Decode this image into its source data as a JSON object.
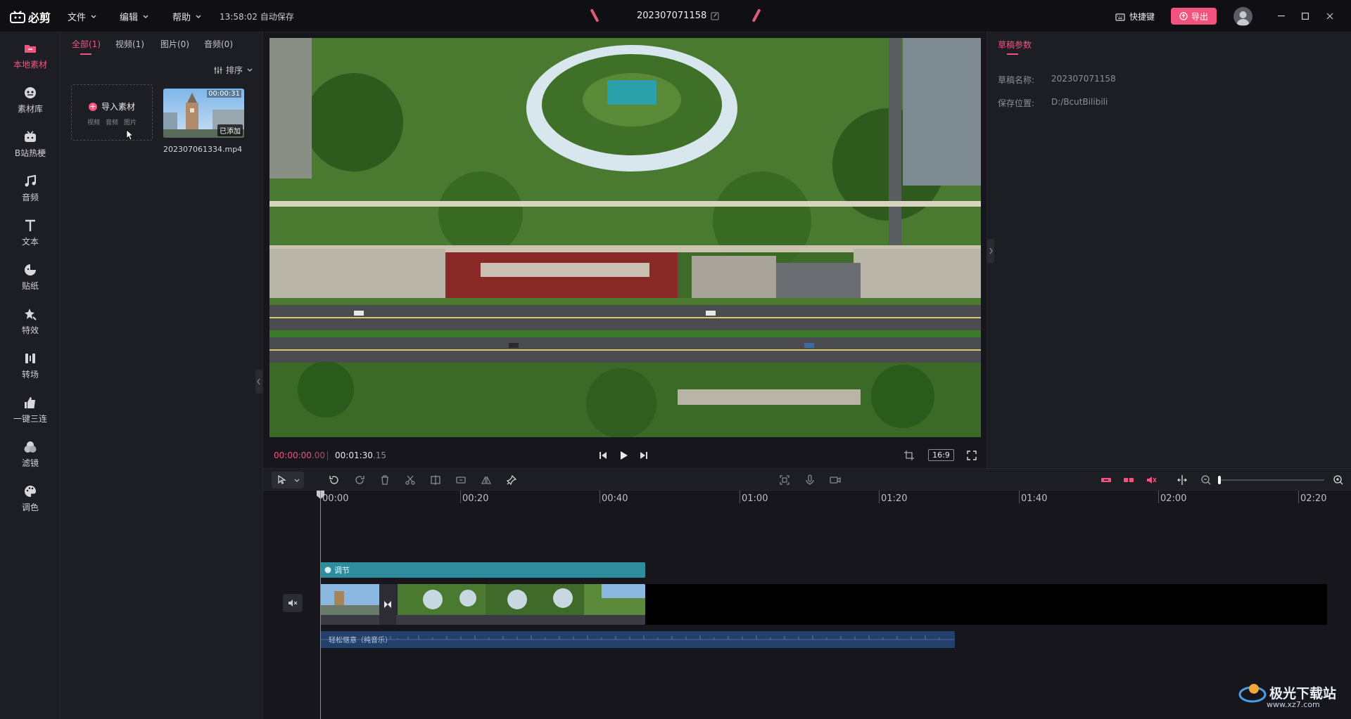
{
  "app": {
    "logo": "必剪",
    "autosave": "13:58:02 自动保存",
    "project_title": "202307071158"
  },
  "menus": [
    {
      "label": "文件"
    },
    {
      "label": "编辑"
    },
    {
      "label": "帮助"
    }
  ],
  "topbar": {
    "shortcut_label": "快捷键",
    "export_label": "导出"
  },
  "sidebar": {
    "items": [
      {
        "label": "本地素材",
        "icon": "folder-icon",
        "active": true
      },
      {
        "label": "素材库",
        "icon": "material-library-icon"
      },
      {
        "label": "B站热梗",
        "icon": "bilibili-tv-icon"
      },
      {
        "label": "音频",
        "icon": "music-note-icon"
      },
      {
        "label": "文本",
        "icon": "text-icon"
      },
      {
        "label": "贴纸",
        "icon": "sticker-icon"
      },
      {
        "label": "特效",
        "icon": "effects-star-icon"
      },
      {
        "label": "转场",
        "icon": "transition-icon"
      },
      {
        "label": "一键三连",
        "icon": "thumbs-up-icon"
      },
      {
        "label": "滤镜",
        "icon": "filter-icon"
      },
      {
        "label": "调色",
        "icon": "palette-icon"
      }
    ]
  },
  "media": {
    "tabs": [
      {
        "label": "全部(1)"
      },
      {
        "label": "视频(1)"
      },
      {
        "label": "图片(0)"
      },
      {
        "label": "音频(0)"
      }
    ],
    "sort_label": "排序",
    "import": {
      "label": "导入素材",
      "sub": [
        "视频",
        "音频",
        "图片"
      ]
    },
    "clip": {
      "duration": "00:00:31",
      "badge": "已添加",
      "filename": "202307061334.mp4"
    }
  },
  "preview": {
    "current_time": "00:00:00",
    "current_frames": ".00",
    "total_time": "00:01:30",
    "total_frames": ".15",
    "aspect_ratio": "16:9"
  },
  "draft_params": {
    "title": "草稿参数",
    "name_label": "草稿名称:",
    "name_value": "202307071158",
    "location_label": "保存位置:",
    "location_value": "D:/BcutBilibili"
  },
  "timeline": {
    "ruler_labels": [
      "00:00",
      "00:20",
      "00:40",
      "01:00",
      "01:20",
      "01:40",
      "02:00",
      "02:20"
    ],
    "adjust_track_label": "调节",
    "audio_track_label": "轻松惬意（纯音乐）"
  },
  "watermark": {
    "text": "极光下载站",
    "url": "www.xz7.com"
  },
  "colors": {
    "accent": "#f2547f",
    "adjust_track": "#2f8c9c",
    "audio_track": "#23406a"
  }
}
